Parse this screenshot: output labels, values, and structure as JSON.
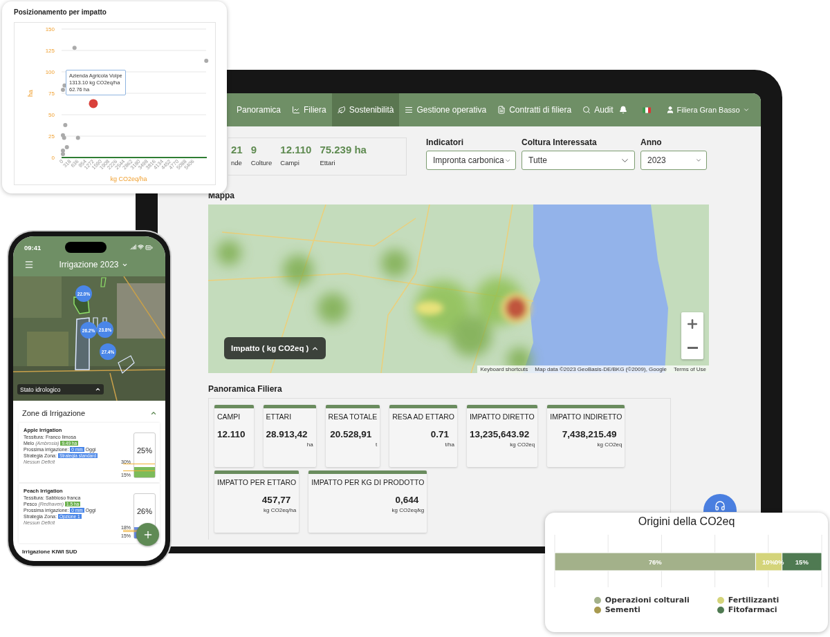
{
  "scatter_card": {
    "title": "Posizionamento per impatto",
    "tooltip": [
      "Azienda Agricola Volpe",
      "1313.10 kg CO2eq/ha",
      "62.76 ha"
    ],
    "chart_data": {
      "type": "scatter",
      "grid": true,
      "xlabel": "kg CO2eq/ha",
      "ylabel": "ha",
      "xlim": [
        0,
        6000
      ],
      "ylim": [
        0,
        150
      ],
      "x": [
        535,
        5979,
        124,
        57,
        153,
        57,
        105,
        678,
        220,
        57,
        57,
        1313.1
      ],
      "xticks": [
        0,
        318,
        636,
        954,
        1272,
        1590,
        1908,
        2226,
        2544,
        2862,
        3180,
        3498,
        3816,
        4134,
        4452,
        4770,
        5088,
        5406
      ],
      "yticks": [
        0,
        25,
        50,
        75,
        100,
        125,
        150
      ],
      "series": [
        {
          "color": "#aaaaaa",
          "values": [
            128,
            113,
            84,
            79,
            38,
            26,
            23,
            23,
            12,
            8,
            4,
            null
          ]
        },
        {
          "color": "#d9413b",
          "values": [
            null,
            null,
            null,
            null,
            null,
            null,
            null,
            null,
            null,
            null,
            null,
            63
          ]
        }
      ]
    }
  },
  "tablet": {
    "nav": [
      {
        "label": "Panoramica",
        "selected": false
      },
      {
        "label": "Filiera",
        "selected": false
      },
      {
        "label": "Sostenibilità",
        "selected": true
      },
      {
        "label": "Gestione operativa",
        "selected": false
      },
      {
        "label": "Contratti di filiera",
        "selected": false
      },
      {
        "label": "Audit",
        "selected": false
      }
    ],
    "user": "Filiera Gran Basso",
    "stats": [
      {
        "value": "21",
        "label": "nde"
      },
      {
        "value": "9",
        "label": "Colture"
      },
      {
        "value": "12.110",
        "label": "Campi"
      },
      {
        "value": "75.239 ha",
        "label": "Ettari"
      }
    ],
    "filters": [
      {
        "label": "Indicatori",
        "value": "Impronta carbonica"
      },
      {
        "label": "Coltura Interessata",
        "value": "Tutte"
      },
      {
        "label": "Anno",
        "value": "2023"
      }
    ],
    "map": {
      "title": "Mappa",
      "legend_button": "Impatto ( kg CO2eq )",
      "footer": [
        "Keyboard shortcuts",
        "Map data ©2023 GeoBasis-DE/BKG (©2009), Google",
        "Terms of Use"
      ]
    },
    "overview": {
      "title": "Panoramica Filiera",
      "cards": [
        {
          "label": "CAMPI",
          "value": "12.110"
        },
        {
          "label": "ETTARI",
          "value": "28.913,42",
          "unit": "ha"
        },
        {
          "label": "RESA TOTALE",
          "value": "20.528,91",
          "unit": "t"
        },
        {
          "label": "RESA AD ETTARO",
          "value": "0.71",
          "unit": "t/ha"
        },
        {
          "label": "IMPATTO DIRETTO",
          "value": "13,235,643.92",
          "unit": "kg CO2eq"
        },
        {
          "label": "IMPATTO INDIRETTO",
          "value": "7,438,215.49",
          "unit": "kg CO2eq"
        },
        {
          "label": "IMPATTO PER ETTARO",
          "value": "457,77",
          "unit": "kg CO2eq/ha"
        },
        {
          "label": "IMPATTO PER KG DI PRODOTTO",
          "value": "0,644",
          "unit": "kg CO2eq/kg"
        }
      ]
    }
  },
  "phone": {
    "time": "09:41",
    "title": "Irrigazione",
    "year": "2023",
    "markers": [
      "22.0%",
      "26.2%",
      "23.8%",
      "27.4%"
    ],
    "map_control": "Stato idrologico",
    "zones": {
      "title": "Zone di Irrigazione",
      "expanded": true,
      "items": [
        {
          "name": "Apple Irrigation",
          "texture": "Tessitura: Franco limosa",
          "crop": "Melo",
          "variety": "(Ambrosia)",
          "area": "9.49 ha",
          "next_label": "Prossima irrigazione:",
          "next_amount": "0 mm",
          "next_when": "Oggi",
          "strategy_label": "Strategia Zona:",
          "strategy": "Strategia standard",
          "deficit": "Nessun Deficit",
          "gauge": {
            "reading": "25%",
            "level": 0.25,
            "color": "#7dbb5a",
            "thresholds": [
              {
                "label": "30%",
                "level": 0.3
              },
              {
                "label": "15%",
                "level": 0.15
              }
            ]
          }
        },
        {
          "name": "Peach Irrigation",
          "texture": "Tessitura: Sabbioso franca",
          "crop": "Pesco",
          "variety": "(Redhaven)",
          "area": "1.5 ha",
          "next_label": "Prossima irrigazione:",
          "next_amount": "0 mm",
          "next_when": "Oggi",
          "strategy_label": "Strategia Zona:",
          "strategy": "Opzione 1",
          "deficit": "Nessun Deficit",
          "gauge": {
            "reading": "26%",
            "level": 0.26,
            "color": "#6b8de3",
            "thresholds": [
              {
                "label": "18%",
                "level": 0.18
              },
              {
                "label": "15%",
                "level": 0.15
              }
            ]
          }
        }
      ],
      "next_item": "Irrigazione KIWI SUD"
    }
  },
  "co2_card": {
    "title": "Origini della CO2eq",
    "chart_data": {
      "type": "bar",
      "orientation": "horizontal",
      "stacked": true,
      "series": [
        {
          "name": "Operazioni colturali",
          "color": "#a3b18a",
          "values": [
            76
          ],
          "value_labels": [
            "76%"
          ]
        },
        {
          "name": "Fertilizzanti",
          "color": "#d4d47a",
          "values": [
            10
          ],
          "value_labels": [
            "10%"
          ]
        },
        {
          "name": "Sementi",
          "color": "#a89a50",
          "values": [
            0
          ],
          "value_labels": [
            "0%"
          ]
        },
        {
          "name": "Fitofarmaci",
          "color": "#4f7a52",
          "values": [
            15
          ],
          "value_labels": [
            "15%"
          ]
        }
      ]
    }
  }
}
